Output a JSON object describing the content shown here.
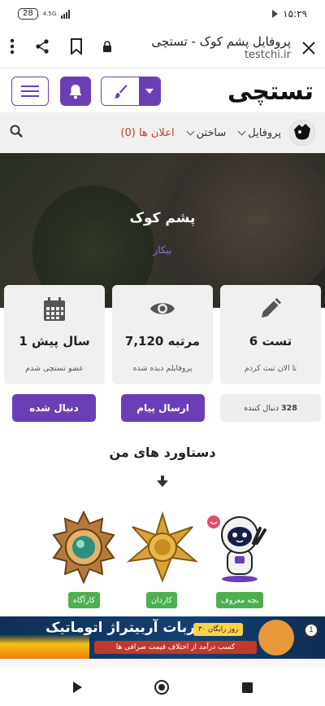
{
  "status_bar": {
    "time": "۱۵:۲۹",
    "battery": "28",
    "network": "4.5G"
  },
  "browser": {
    "title": "پروفایل پشم کوک - تستچی",
    "url": "testchi.ir"
  },
  "header": {
    "logo": "تستچی"
  },
  "nav": {
    "profile": "پروفایل",
    "build": "ساختن",
    "ads": "اعلان ها (0)"
  },
  "profile": {
    "name": "پشم کوک",
    "status": "بیکار"
  },
  "stats": [
    {
      "value": "6 تست",
      "caption": "تا الان ثبت کردم",
      "icon": "pencil-icon"
    },
    {
      "value": "7,120 مرتبه",
      "caption": "پروفایلم دیده شده",
      "icon": "eye-icon"
    },
    {
      "value": "1 سال پیش",
      "caption": "عضو تستچی شدم",
      "icon": "calendar-icon"
    }
  ],
  "actions": {
    "followers_count": "328",
    "followers_label": "دنبال کننده",
    "send_message": "ارسال پیام",
    "followed": "دنبال شده"
  },
  "achievements": {
    "title": "دستاورد های من",
    "badges": [
      {
        "label": "بچه معروف"
      },
      {
        "label": "کاردان"
      },
      {
        "label": "کارآگاه"
      }
    ]
  },
  "ad": {
    "title": "ربات آربیتراژ اتوماتیک",
    "pill": "۳۰ روز رایگان",
    "subtitle": "کسب درآمد از اختلاف قیمت صرافی ها",
    "coin": "1"
  },
  "colors": {
    "accent": "#6a3fb5",
    "badge_green": "#4caf50",
    "ads_red": "#c0392b"
  }
}
